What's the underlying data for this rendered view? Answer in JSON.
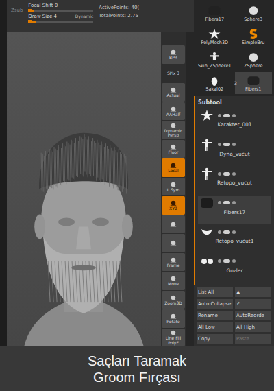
{
  "top_bar": {
    "left_label": "Zsub",
    "sliders": [
      {
        "label": "Focal Shift 0",
        "level": 0.08
      },
      {
        "label": "Draw Size 4",
        "level": 0.12
      }
    ],
    "dynamic": "Dynamic",
    "active_points": "ActivePoints: 40(",
    "total_points": "TotalPoints: 2.75"
  },
  "brushes": [
    {
      "label": "Fibers17",
      "kind": "hair",
      "selected": false
    },
    {
      "label": "Sphere3",
      "kind": "sphere",
      "selected": false
    },
    {
      "label": "PolyMesh3D",
      "kind": "star",
      "selected": false
    },
    {
      "label": "SimpleBru",
      "kind": "s",
      "selected": false
    },
    {
      "label": "Skin_ZSphere1",
      "kind": "figure",
      "selected": false
    },
    {
      "label": "ZSphere",
      "kind": "sphere",
      "selected": false
    },
    {
      "label": "Sakal02",
      "kind": "beard",
      "selected": false
    },
    {
      "label": "Fibers1",
      "kind": "hair",
      "selected": true
    }
  ],
  "brush_count": "3",
  "tools": [
    {
      "label": "BPR",
      "kind": "icon",
      "active": false
    },
    {
      "label": "SPix 3",
      "kind": "text",
      "active": false
    },
    {
      "label": "Actual",
      "kind": "icon",
      "active": false
    },
    {
      "label": "AAHalf",
      "kind": "icon",
      "active": false
    },
    {
      "label": "Dynamic\nPersp",
      "kind": "icon",
      "active": false
    },
    {
      "label": "Floor",
      "kind": "icon",
      "active": false
    },
    {
      "label": "Local",
      "kind": "icon",
      "active": true
    },
    {
      "label": "L.Sym",
      "kind": "icon",
      "active": false
    },
    {
      "label": "XYZ",
      "kind": "icon",
      "active": true
    },
    {
      "label": "",
      "kind": "icon",
      "active": false
    },
    {
      "label": "",
      "kind": "icon",
      "active": false
    },
    {
      "label": "Frame",
      "kind": "icon",
      "active": false
    },
    {
      "label": "Move",
      "kind": "icon",
      "active": false
    },
    {
      "label": "Zoom3D",
      "kind": "icon",
      "active": false
    },
    {
      "label": "Rotate",
      "kind": "icon",
      "active": false
    },
    {
      "label": "Line Fill\nPolyF",
      "kind": "icon",
      "active": false
    }
  ],
  "subtool": {
    "title": "Subtool",
    "items": [
      {
        "name": "Karakter_001",
        "kind": "star",
        "selected": false
      },
      {
        "name": "Dyna_vucut",
        "kind": "figure",
        "selected": false
      },
      {
        "name": "Retopo_vucut",
        "kind": "figure",
        "selected": false
      },
      {
        "name": "Fibers17",
        "kind": "hair",
        "selected": true
      },
      {
        "name": "Retopo_vucut1",
        "kind": "beard",
        "selected": false
      },
      {
        "name": "Gozler",
        "kind": "spheres",
        "selected": false
      }
    ]
  },
  "buttons": [
    {
      "label": "List All",
      "disabled": false
    },
    {
      "label": "▲",
      "disabled": false
    },
    {
      "label": "Auto Collapse",
      "disabled": false
    },
    {
      "label": "↱",
      "disabled": false
    },
    {
      "label": "Rename",
      "disabled": false
    },
    {
      "label": "AutoReorde",
      "disabled": false
    },
    {
      "label": "All Low",
      "disabled": false
    },
    {
      "label": "All High",
      "disabled": false
    },
    {
      "label": "Copy",
      "disabled": false
    },
    {
      "label": "Paste",
      "disabled": true
    }
  ],
  "caption": [
    "Saçları Taramak",
    "Groom Fırçası"
  ]
}
